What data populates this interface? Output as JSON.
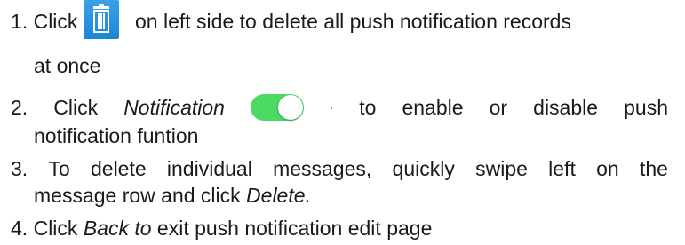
{
  "colors": {
    "toggle_on": "#4cd964",
    "trash_bg": "#1d86d4"
  },
  "icons": {
    "trash": "trash-icon",
    "toggle": "toggle-switch-on"
  },
  "items": [
    {
      "number": "1.",
      "before": "Click",
      "after": "on left side to delete all push notification records",
      "continuation": "at once"
    },
    {
      "number": "2.",
      "before": "Click",
      "emphasis": "Notification",
      "separator": "·",
      "after_words": [
        "to",
        "enable",
        "or",
        "disable",
        "push"
      ],
      "continuation": "notification funtion"
    },
    {
      "number": "3.",
      "line1_words": [
        "To",
        "delete",
        "individual",
        "messages,",
        "quickly",
        "swipe",
        "left",
        "on",
        "the"
      ],
      "line2_text": "message row and click",
      "line2_emphasis": "Delete."
    },
    {
      "number": "4.",
      "before": "Click",
      "emphasis": "Back to",
      "after": "exit push notification edit page"
    }
  ]
}
